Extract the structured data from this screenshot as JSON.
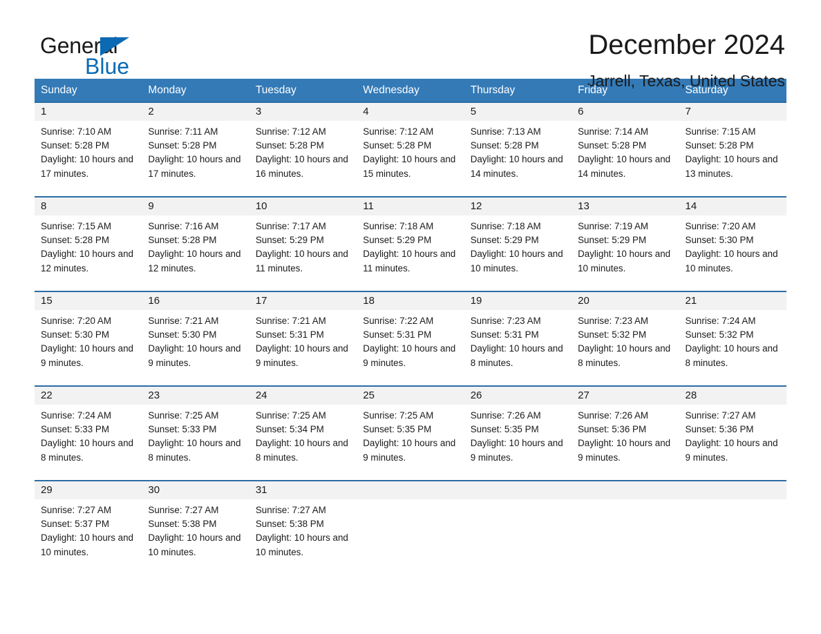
{
  "logo": {
    "word_general": "General",
    "word_blue": "Blue",
    "triangle_color": "#0a6ab4"
  },
  "header": {
    "title": "December 2024",
    "location": "Jarrell, Texas, United States"
  },
  "theme": {
    "header_blue": "#337ab7",
    "row_rule_blue": "#2a6ca6",
    "day_band_gray": "#f2f2f2"
  },
  "calendar": {
    "weekdays": [
      "Sunday",
      "Monday",
      "Tuesday",
      "Wednesday",
      "Thursday",
      "Friday",
      "Saturday"
    ],
    "weeks": [
      [
        {
          "day": "1",
          "sunrise": "Sunrise: 7:10 AM",
          "sunset": "Sunset: 5:28 PM",
          "daylight": "Daylight: 10 hours and 17 minutes."
        },
        {
          "day": "2",
          "sunrise": "Sunrise: 7:11 AM",
          "sunset": "Sunset: 5:28 PM",
          "daylight": "Daylight: 10 hours and 17 minutes."
        },
        {
          "day": "3",
          "sunrise": "Sunrise: 7:12 AM",
          "sunset": "Sunset: 5:28 PM",
          "daylight": "Daylight: 10 hours and 16 minutes."
        },
        {
          "day": "4",
          "sunrise": "Sunrise: 7:12 AM",
          "sunset": "Sunset: 5:28 PM",
          "daylight": "Daylight: 10 hours and 15 minutes."
        },
        {
          "day": "5",
          "sunrise": "Sunrise: 7:13 AM",
          "sunset": "Sunset: 5:28 PM",
          "daylight": "Daylight: 10 hours and 14 minutes."
        },
        {
          "day": "6",
          "sunrise": "Sunrise: 7:14 AM",
          "sunset": "Sunset: 5:28 PM",
          "daylight": "Daylight: 10 hours and 14 minutes."
        },
        {
          "day": "7",
          "sunrise": "Sunrise: 7:15 AM",
          "sunset": "Sunset: 5:28 PM",
          "daylight": "Daylight: 10 hours and 13 minutes."
        }
      ],
      [
        {
          "day": "8",
          "sunrise": "Sunrise: 7:15 AM",
          "sunset": "Sunset: 5:28 PM",
          "daylight": "Daylight: 10 hours and 12 minutes."
        },
        {
          "day": "9",
          "sunrise": "Sunrise: 7:16 AM",
          "sunset": "Sunset: 5:28 PM",
          "daylight": "Daylight: 10 hours and 12 minutes."
        },
        {
          "day": "10",
          "sunrise": "Sunrise: 7:17 AM",
          "sunset": "Sunset: 5:29 PM",
          "daylight": "Daylight: 10 hours and 11 minutes."
        },
        {
          "day": "11",
          "sunrise": "Sunrise: 7:18 AM",
          "sunset": "Sunset: 5:29 PM",
          "daylight": "Daylight: 10 hours and 11 minutes."
        },
        {
          "day": "12",
          "sunrise": "Sunrise: 7:18 AM",
          "sunset": "Sunset: 5:29 PM",
          "daylight": "Daylight: 10 hours and 10 minutes."
        },
        {
          "day": "13",
          "sunrise": "Sunrise: 7:19 AM",
          "sunset": "Sunset: 5:29 PM",
          "daylight": "Daylight: 10 hours and 10 minutes."
        },
        {
          "day": "14",
          "sunrise": "Sunrise: 7:20 AM",
          "sunset": "Sunset: 5:30 PM",
          "daylight": "Daylight: 10 hours and 10 minutes."
        }
      ],
      [
        {
          "day": "15",
          "sunrise": "Sunrise: 7:20 AM",
          "sunset": "Sunset: 5:30 PM",
          "daylight": "Daylight: 10 hours and 9 minutes."
        },
        {
          "day": "16",
          "sunrise": "Sunrise: 7:21 AM",
          "sunset": "Sunset: 5:30 PM",
          "daylight": "Daylight: 10 hours and 9 minutes."
        },
        {
          "day": "17",
          "sunrise": "Sunrise: 7:21 AM",
          "sunset": "Sunset: 5:31 PM",
          "daylight": "Daylight: 10 hours and 9 minutes."
        },
        {
          "day": "18",
          "sunrise": "Sunrise: 7:22 AM",
          "sunset": "Sunset: 5:31 PM",
          "daylight": "Daylight: 10 hours and 9 minutes."
        },
        {
          "day": "19",
          "sunrise": "Sunrise: 7:23 AM",
          "sunset": "Sunset: 5:31 PM",
          "daylight": "Daylight: 10 hours and 8 minutes."
        },
        {
          "day": "20",
          "sunrise": "Sunrise: 7:23 AM",
          "sunset": "Sunset: 5:32 PM",
          "daylight": "Daylight: 10 hours and 8 minutes."
        },
        {
          "day": "21",
          "sunrise": "Sunrise: 7:24 AM",
          "sunset": "Sunset: 5:32 PM",
          "daylight": "Daylight: 10 hours and 8 minutes."
        }
      ],
      [
        {
          "day": "22",
          "sunrise": "Sunrise: 7:24 AM",
          "sunset": "Sunset: 5:33 PM",
          "daylight": "Daylight: 10 hours and 8 minutes."
        },
        {
          "day": "23",
          "sunrise": "Sunrise: 7:25 AM",
          "sunset": "Sunset: 5:33 PM",
          "daylight": "Daylight: 10 hours and 8 minutes."
        },
        {
          "day": "24",
          "sunrise": "Sunrise: 7:25 AM",
          "sunset": "Sunset: 5:34 PM",
          "daylight": "Daylight: 10 hours and 8 minutes."
        },
        {
          "day": "25",
          "sunrise": "Sunrise: 7:25 AM",
          "sunset": "Sunset: 5:35 PM",
          "daylight": "Daylight: 10 hours and 9 minutes."
        },
        {
          "day": "26",
          "sunrise": "Sunrise: 7:26 AM",
          "sunset": "Sunset: 5:35 PM",
          "daylight": "Daylight: 10 hours and 9 minutes."
        },
        {
          "day": "27",
          "sunrise": "Sunrise: 7:26 AM",
          "sunset": "Sunset: 5:36 PM",
          "daylight": "Daylight: 10 hours and 9 minutes."
        },
        {
          "day": "28",
          "sunrise": "Sunrise: 7:27 AM",
          "sunset": "Sunset: 5:36 PM",
          "daylight": "Daylight: 10 hours and 9 minutes."
        }
      ],
      [
        {
          "day": "29",
          "sunrise": "Sunrise: 7:27 AM",
          "sunset": "Sunset: 5:37 PM",
          "daylight": "Daylight: 10 hours and 10 minutes."
        },
        {
          "day": "30",
          "sunrise": "Sunrise: 7:27 AM",
          "sunset": "Sunset: 5:38 PM",
          "daylight": "Daylight: 10 hours and 10 minutes."
        },
        {
          "day": "31",
          "sunrise": "Sunrise: 7:27 AM",
          "sunset": "Sunset: 5:38 PM",
          "daylight": "Daylight: 10 hours and 10 minutes."
        },
        {
          "day": "",
          "sunrise": "",
          "sunset": "",
          "daylight": ""
        },
        {
          "day": "",
          "sunrise": "",
          "sunset": "",
          "daylight": ""
        },
        {
          "day": "",
          "sunrise": "",
          "sunset": "",
          "daylight": ""
        },
        {
          "day": "",
          "sunrise": "",
          "sunset": "",
          "daylight": ""
        }
      ]
    ]
  }
}
